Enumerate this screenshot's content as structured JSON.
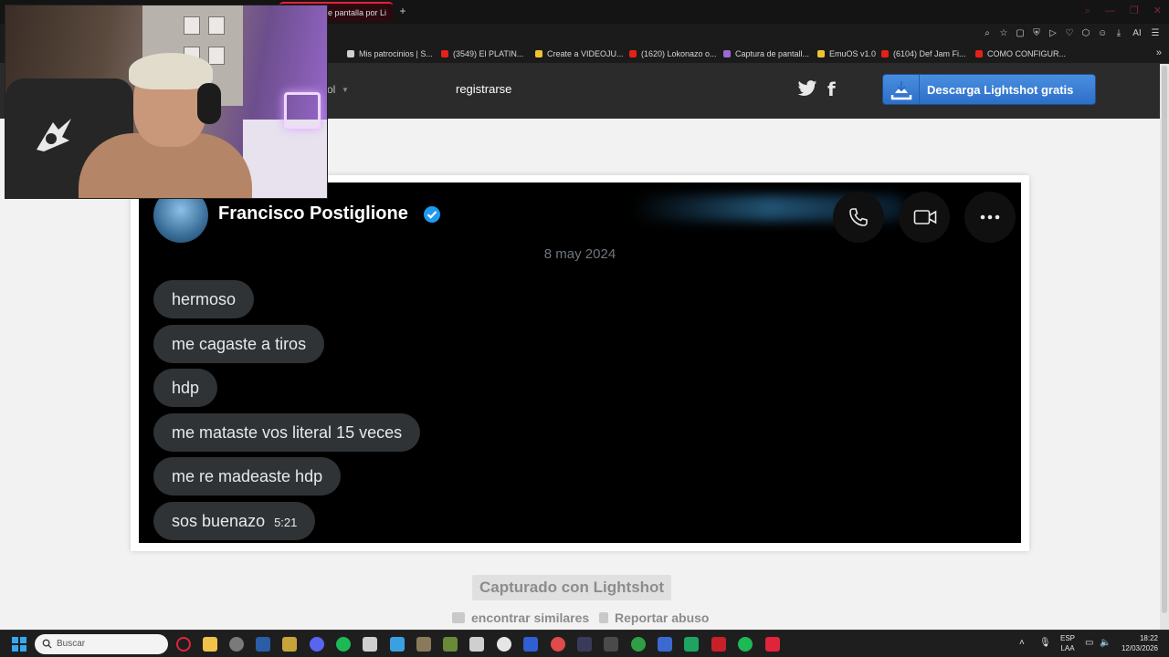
{
  "browser": {
    "active_tab_label": "de pantalla por Li",
    "new_tab_icon": "plus-icon",
    "bookmarks": [
      {
        "label": "Mis patrocinios | S...",
        "color": "#d0d0d0"
      },
      {
        "label": "(3549) El PLATIN...",
        "color": "#e62117"
      },
      {
        "label": "Create a VIDEOJU...",
        "color": "#f2c230"
      },
      {
        "label": "(1620) Lokonazo o...",
        "color": "#e62117"
      },
      {
        "label": "Captura de pantall...",
        "color": "#9b6ad2"
      },
      {
        "label": "EmuOS v1.0",
        "color": "#f2c230"
      },
      {
        "label": "(6104) Def Jam Fi...",
        "color": "#e62117"
      },
      {
        "label": "COMO CONFIGUR...",
        "color": "#e62117"
      }
    ],
    "toolbar_ai_label": "AI"
  },
  "lightshot": {
    "language": "ol",
    "register_label": "registrarse",
    "download_label": "Descarga Lightshot gratis",
    "captured_label": "Capturado con Lightshot",
    "find_similar_label": "encontrar similares",
    "report_label": "Reportar abuso"
  },
  "chat": {
    "contact_name": "Francisco Postiglione",
    "date": "8 may 2024",
    "messages": [
      {
        "text": "hermoso"
      },
      {
        "text": "me cagaste a tiros"
      },
      {
        "text": "hdp"
      },
      {
        "text": "me mataste vos literal 15 veces"
      },
      {
        "text": "me re madeaste hdp"
      },
      {
        "text": "sos buenazo",
        "time": "5:21"
      }
    ],
    "colors": {
      "bubble": "#2f3336",
      "verified": "#1d9bf0",
      "background": "#000000"
    }
  },
  "taskbar": {
    "search_placeholder": "Buscar",
    "language_line1": "ESP",
    "language_line2": "LAA",
    "time": "18:22",
    "date": "12/03/2026"
  }
}
